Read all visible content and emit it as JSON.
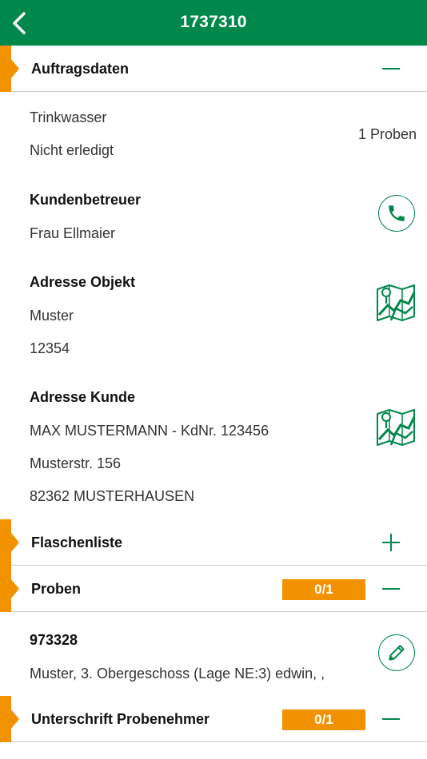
{
  "header": {
    "title": "1737310",
    "back_icon": "chevron-left-icon"
  },
  "colors": {
    "brand_green": "#00874a",
    "accent_orange": "#f39200",
    "divider": "#c8c8c8"
  },
  "auftragsdaten": {
    "label": "Auftragsdaten",
    "toggle_icon": "minus-icon",
    "type": "Trinkwasser",
    "status": "Nicht erledigt",
    "samples_count": "1 Proben",
    "kundenbetreuer": {
      "label": "Kundenbetreuer",
      "name": "Frau Ellmaier",
      "icon": "phone-icon"
    },
    "adresse_objekt": {
      "label": "Adresse Objekt",
      "line1": "Muster",
      "line2": "12354",
      "icon": "map-icon"
    },
    "adresse_kunde": {
      "label": "Adresse Kunde",
      "line1": "MAX MUSTERMANN - KdNr. 123456",
      "line2": "Musterstr. 156",
      "line3": "82362 MUSTERHAUSEN",
      "icon": "map-icon"
    }
  },
  "flaschenliste": {
    "label": "Flaschenliste",
    "toggle_icon": "plus-icon"
  },
  "proben": {
    "label": "Proben",
    "badge": "0/1",
    "toggle_icon": "minus-icon",
    "item": {
      "id": "973328",
      "description": "Muster, 3. Obergeschoss (Lage NE:3) edwin, ,",
      "icon": "pencil-icon"
    }
  },
  "unterschrift": {
    "label": "Unterschrift Probenehmer",
    "badge": "0/1",
    "toggle_icon": "minus-icon"
  }
}
